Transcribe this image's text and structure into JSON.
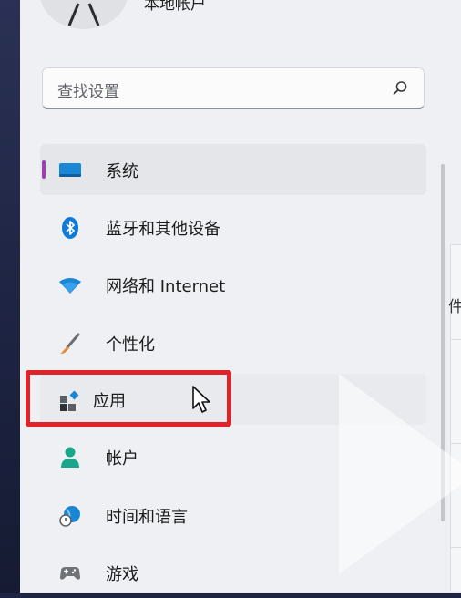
{
  "account": {
    "name": "本地帐户"
  },
  "search": {
    "placeholder": "查找设置"
  },
  "nav": {
    "items": [
      {
        "label": "系统",
        "icon": "monitor-icon",
        "state": "selected"
      },
      {
        "label": "蓝牙和其他设备",
        "icon": "bluetooth-icon"
      },
      {
        "label": "网络和 Internet",
        "icon": "wifi-icon"
      },
      {
        "label": "个性化",
        "icon": "paintbrush-icon"
      },
      {
        "label": "应用",
        "icon": "apps-icon",
        "state": "hover",
        "highlighted": true
      },
      {
        "label": "帐户",
        "icon": "person-icon"
      },
      {
        "label": "时间和语言",
        "icon": "clock-globe-icon"
      },
      {
        "label": "游戏",
        "icon": "gamepad-icon"
      }
    ]
  },
  "content": {
    "partial_char": "件"
  },
  "colors": {
    "accent": "#9b3fb5",
    "highlight": "#e0222b",
    "bluetooth": "#0f7ad8"
  }
}
